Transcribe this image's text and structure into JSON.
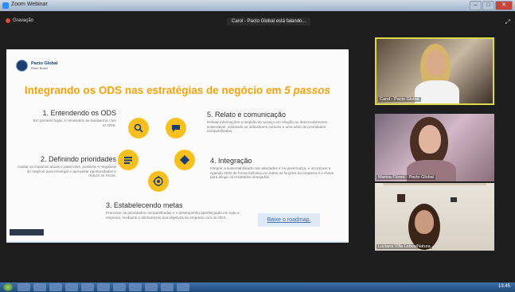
{
  "window": {
    "title": "Zoom Webinar"
  },
  "meeting": {
    "recording_label": "Gravação",
    "speaking_label": "Carol - Pacto Global está falando..."
  },
  "slide": {
    "logo_line1": "Pacto Global",
    "logo_line2": "Rede Brasil",
    "title_main": "Integrando os ODS nas estratégias de negócio em ",
    "title_emph": "5 passos",
    "steps": [
      {
        "title": "1. Entendendo os ODS",
        "text": "Em primeiro lugar, é necessário se familiarizar com os ODS."
      },
      {
        "title": "2. Definindo prioridades",
        "text": "Avaliar os impactos atuais e potenciais, positivos e negativos do negócio para enxergar e aproveitar oportunidades e reduzir os riscos."
      },
      {
        "title": "3. Estabelecendo metas",
        "text": "Promover as prioridades compartilhadas e o desempenho aperfeiçoado em toda a empresa, mediante o alinhamento dos objetivos da empresa com os ODS."
      },
      {
        "title": "4. Integração",
        "text": "Integrar a sustentabilidade nas atividades e na governança, e incorporar a Agenda 2030 de forma holística em todas as funções da empresa é a chave para atingir os resultados desejados."
      },
      {
        "title": "5. Relato e comunicação",
        "text": "Relatar informações a respeito do avanço em relação ao desenvolvimento sustentável, utilizando os indicadores comuns e uma série de prioridades compartilhadas."
      }
    ],
    "roadmap_link": "Baixe o roadmap.",
    "icon_color": "#f7c01e",
    "title_color": "#f2a20d"
  },
  "participants": [
    {
      "name": "Carol - Pacto Global"
    },
    {
      "name": "Marina Flores - Pacto Global"
    },
    {
      "name": "Luciana Villa Lobos/Natura"
    }
  ],
  "taskbar": {
    "clock": "13:45"
  }
}
